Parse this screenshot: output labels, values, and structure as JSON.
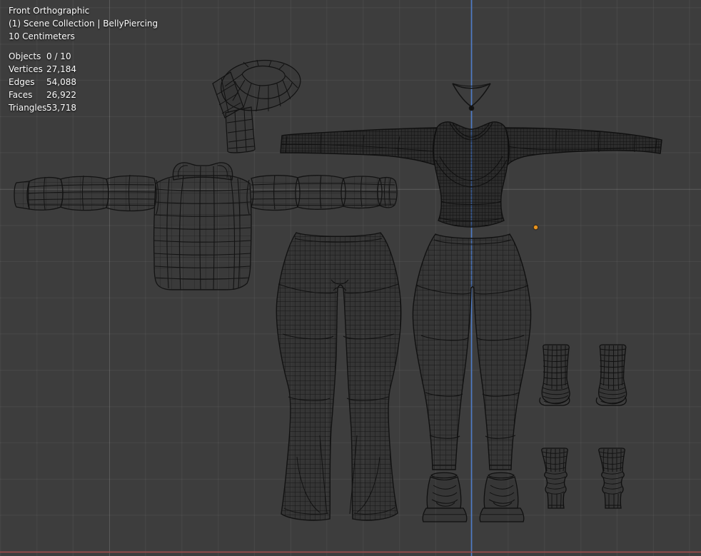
{
  "viewport_overlay": {
    "view_name": "Front Orthographic",
    "scene_breadcrumb": "(1) Scene Collection | BellyPiercing",
    "grid_scale": "10 Centimeters",
    "stats": {
      "rows": [
        {
          "label": "Objects",
          "value": "0 / 10"
        },
        {
          "label": "Vertices",
          "value": "27,184"
        },
        {
          "label": "Edges",
          "value": "54,088"
        },
        {
          "label": "Faces",
          "value": "26,922"
        },
        {
          "label": "Triangles",
          "value": "53,718"
        }
      ]
    }
  },
  "colors": {
    "background": "#3d3d3d",
    "grid_line": "#4a4a4a",
    "axis_z_blue": "#4e7cc9",
    "axis_x_red": "#a84a4a",
    "wireframe": "#101010",
    "origin_point_orange": "#e8941f",
    "overlay_text": "#fdfdfd"
  },
  "scene_objects": [
    "scarf",
    "necklace",
    "puffer-jacket",
    "fitted-long-sleeve-top",
    "flared-pants",
    "leggings-with-sneakers",
    "socks-pair",
    "leg-warmers-pair"
  ]
}
